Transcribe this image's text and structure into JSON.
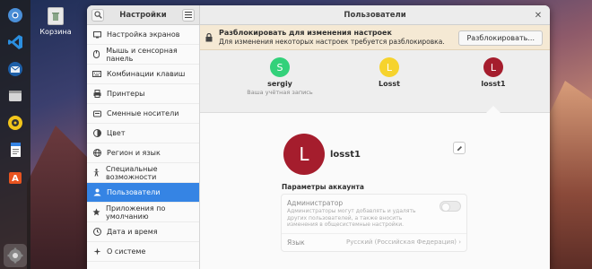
{
  "desktop": {
    "trash_label": "Корзина"
  },
  "dock": {
    "items": [
      "chromium-icon",
      "vscode-icon",
      "thunderbird-icon",
      "files-icon",
      "rhythmbox-icon",
      "writer-icon",
      "appstore-icon",
      "settings-icon"
    ]
  },
  "window": {
    "sidebar_title": "Настройки",
    "main_title": "Пользователи"
  },
  "sidebar": {
    "items": [
      {
        "label": "Настройка экранов",
        "icon": "display-icon"
      },
      {
        "label": "Мышь и сенсорная панель",
        "icon": "mouse-icon"
      },
      {
        "label": "Комбинации клавиш",
        "icon": "keyboard-icon"
      },
      {
        "label": "Принтеры",
        "icon": "printer-icon"
      },
      {
        "label": "Сменные носители",
        "icon": "removable-media-icon"
      },
      {
        "label": "Цвет",
        "icon": "color-icon"
      },
      {
        "label": "Регион и язык",
        "icon": "region-icon"
      },
      {
        "label": "Специальные возможности",
        "icon": "accessibility-icon"
      },
      {
        "label": "Пользователи",
        "icon": "users-icon"
      },
      {
        "label": "Приложения по умолчанию",
        "icon": "default-apps-icon"
      },
      {
        "label": "Дата и время",
        "icon": "clock-icon"
      },
      {
        "label": "О системе",
        "icon": "info-icon"
      }
    ],
    "selected_index": 8
  },
  "unlock": {
    "title": "Разблокировать для изменения настроек",
    "description": "Для изменения некоторых настроек требуется разблокировка.",
    "button": "Разблокировать..."
  },
  "users": [
    {
      "initial": "S",
      "name": "sergiy",
      "subtitle": "Ваша учётная запись",
      "color": "#33d17a"
    },
    {
      "initial": "L",
      "name": "Losst",
      "subtitle": "",
      "color": "#f6d32d"
    },
    {
      "initial": "L",
      "name": "losst1",
      "subtitle": "",
      "color": "#a51d2d"
    }
  ],
  "profile": {
    "initial": "L",
    "name": "losst1"
  },
  "account": {
    "section_title": "Параметры аккаунта",
    "admin_title": "Администратор",
    "admin_desc": "Администраторы могут добавлять и удалять других пользователей, а также вносить изменения в общесистемные настройки.",
    "language_label": "Язык",
    "language_value": "Русский (Российская Федерация)"
  }
}
